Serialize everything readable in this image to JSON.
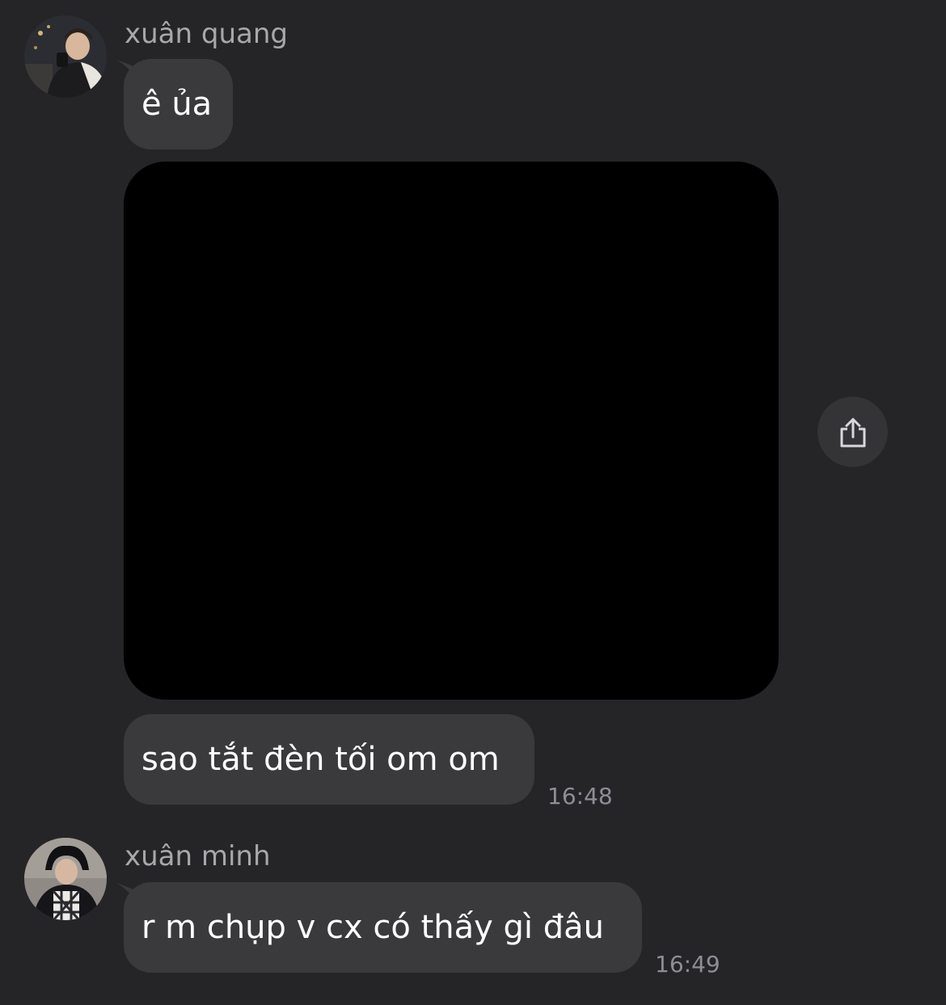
{
  "conversation": {
    "groups": [
      {
        "sender": "xuân quang",
        "avatar": "avatar-photo",
        "messages": [
          {
            "type": "text",
            "text": "ê ủa"
          },
          {
            "type": "image",
            "description_icon": "share-icon"
          },
          {
            "type": "text",
            "text": "sao tắt đèn tối om om",
            "time": "16:48"
          }
        ]
      },
      {
        "sender": "xuân minh",
        "avatar": "avatar-photo",
        "messages": [
          {
            "type": "text",
            "text": "r m chụp v cx có thấy gì đâu",
            "time": "16:49"
          }
        ]
      }
    ]
  },
  "colors": {
    "background": "#252527",
    "bubble": "#3a3a3c",
    "sender_name": "#a8a8ab",
    "timestamp": "#8e8e93",
    "message_text": "#ffffff"
  }
}
